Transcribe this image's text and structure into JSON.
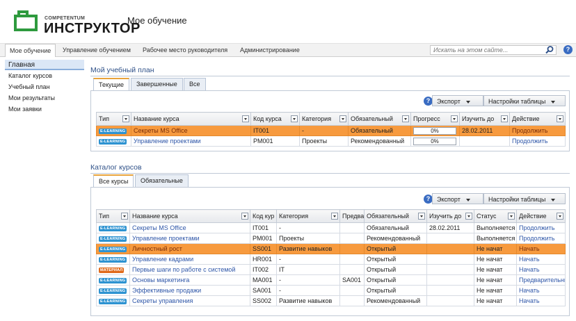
{
  "brand": {
    "top": "COMPETENTUM",
    "bottom": "ИНСТРУКТОР",
    "site_title": "Мое обучение"
  },
  "topnav": {
    "items": [
      "Мое обучение",
      "Управление обучением",
      "Рабочее место руководителя",
      "Администрирование"
    ],
    "search_placeholder": "Искать на этом сайте...",
    "help": "?"
  },
  "leftnav": {
    "head": "Главная",
    "items": [
      "Каталог курсов",
      "Учебный план",
      "Мои результаты",
      "Мои заявки"
    ]
  },
  "plan": {
    "title": "Мой учебный план",
    "tabs": [
      "Текущие",
      "Завершенные",
      "Все"
    ],
    "export": "Экспорт",
    "settings": "Настройки таблицы",
    "columns": [
      "Тип",
      "Название курса",
      "Код курса",
      "Категория",
      "Обязательный",
      "Прогресс",
      "Изучить до",
      "Действие"
    ],
    "rows": [
      {
        "type": "E-LEARNING",
        "name": "Секреты MS Office",
        "code": "IT001",
        "category": "-",
        "required": "Обязательный",
        "progress": "0%",
        "due": "28.02.2011",
        "action": "Продолжить"
      },
      {
        "type": "E-LEARNING",
        "name": "Управление проектами",
        "code": "PM001",
        "category": "Проекты",
        "required": "Рекомендованный",
        "progress": "0%",
        "due": "",
        "action": "Продолжить"
      }
    ]
  },
  "catalog": {
    "title": "Каталог курсов",
    "tabs": [
      "Все курсы",
      "Обязательные"
    ],
    "export": "Экспорт",
    "settings": "Настройки таблицы",
    "columns": [
      "Тип",
      "Название курса",
      "Код кур",
      "Категория",
      "Предва",
      "Обязательный",
      "Изучить до",
      "Статус",
      "Действие"
    ],
    "rows": [
      {
        "type": "E-LEARNING",
        "name": "Секреты MS Office",
        "code": "IT001",
        "category": "-",
        "pre": "",
        "required": "Обязательный",
        "due": "28.02.2011",
        "status": "Выполняется",
        "action": "Продолжить"
      },
      {
        "type": "E-LEARNING",
        "name": "Управление проектами",
        "code": "PM001",
        "category": "Проекты",
        "pre": "",
        "required": "Рекомендованный",
        "due": "",
        "status": "Выполняется",
        "action": "Продолжить"
      },
      {
        "type": "E-LEARNING",
        "name": "Личностный рост",
        "code": "SS001",
        "category": "Развитие навыков",
        "pre": "",
        "required": "Открытый",
        "due": "",
        "status": "Не начат",
        "action": "Начать"
      },
      {
        "type": "E-LEARNING",
        "name": "Управление кадрами",
        "code": "HR001",
        "category": "-",
        "pre": "",
        "required": "Открытый",
        "due": "",
        "status": "Не начат",
        "action": "Начать"
      },
      {
        "type": "МАТЕРИАЛ",
        "name": "Первые шаги по работе с системой",
        "code": "IT002",
        "category": "IT",
        "pre": "",
        "required": "Открытый",
        "due": "",
        "status": "Не начат",
        "action": "Начать"
      },
      {
        "type": "E-LEARNING",
        "name": "Основы маркетинга",
        "code": "MA001",
        "category": "-",
        "pre": "SA001",
        "required": "Открытый",
        "due": "",
        "status": "Не начат",
        "action": "Предварительные"
      },
      {
        "type": "E-LEARNING",
        "name": "Эффективные продажи",
        "code": "SA001",
        "category": "-",
        "pre": "",
        "required": "Открытый",
        "due": "",
        "status": "Не начат",
        "action": "Начать"
      },
      {
        "type": "E-LEARNING",
        "name": "Секреты управления",
        "code": "SS002",
        "category": "Развитие навыков",
        "pre": "",
        "required": "Рекомендованный",
        "due": "",
        "status": "Не начат",
        "action": "Начать"
      }
    ]
  }
}
